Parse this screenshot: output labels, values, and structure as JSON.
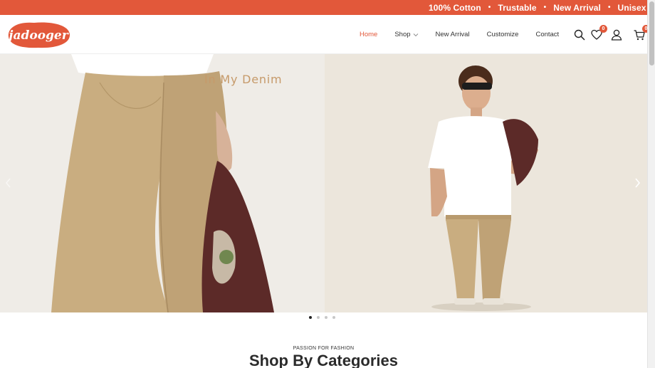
{
  "marquee": {
    "items": [
      "100% Cotton",
      "Trustable",
      "New Arrival",
      "Unisex Prod"
    ],
    "separator": "•"
  },
  "brand": {
    "logo_text": "jadooger",
    "accent_color": "#e2583a"
  },
  "nav": {
    "items": [
      {
        "label": "Home",
        "active": true
      },
      {
        "label": "Shop",
        "has_dropdown": true
      },
      {
        "label": "New Arrival"
      },
      {
        "label": "Customize"
      },
      {
        "label": "Contact"
      }
    ]
  },
  "header_icons": {
    "search": "search-icon",
    "wishlist": "heart-icon",
    "wishlist_count": "0",
    "account": "user-icon",
    "cart": "cart-icon",
    "cart_count": "0"
  },
  "hero": {
    "title": "In My Denim",
    "slide_count": 4,
    "active_slide": 1
  },
  "section": {
    "eyebrow": "PASSION FOR FASHION",
    "title": "Shop By Categories"
  }
}
